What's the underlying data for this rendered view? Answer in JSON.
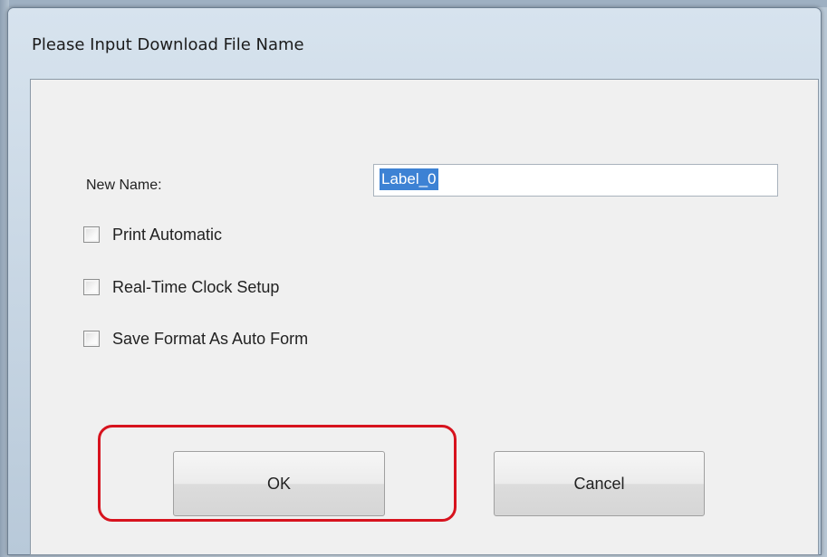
{
  "dialog": {
    "title": "Please Input Download File Name",
    "new_name_label": "New Name:",
    "new_name_value": "Label_0",
    "checkboxes": [
      {
        "label": "Print Automatic",
        "checked": false
      },
      {
        "label": "Real-Time Clock Setup",
        "checked": false
      },
      {
        "label": "Save Format As Auto Form",
        "checked": false
      }
    ],
    "ok_label": "OK",
    "cancel_label": "Cancel"
  },
  "colors": {
    "highlight": "#d7131e",
    "selection": "#3d82d4"
  }
}
